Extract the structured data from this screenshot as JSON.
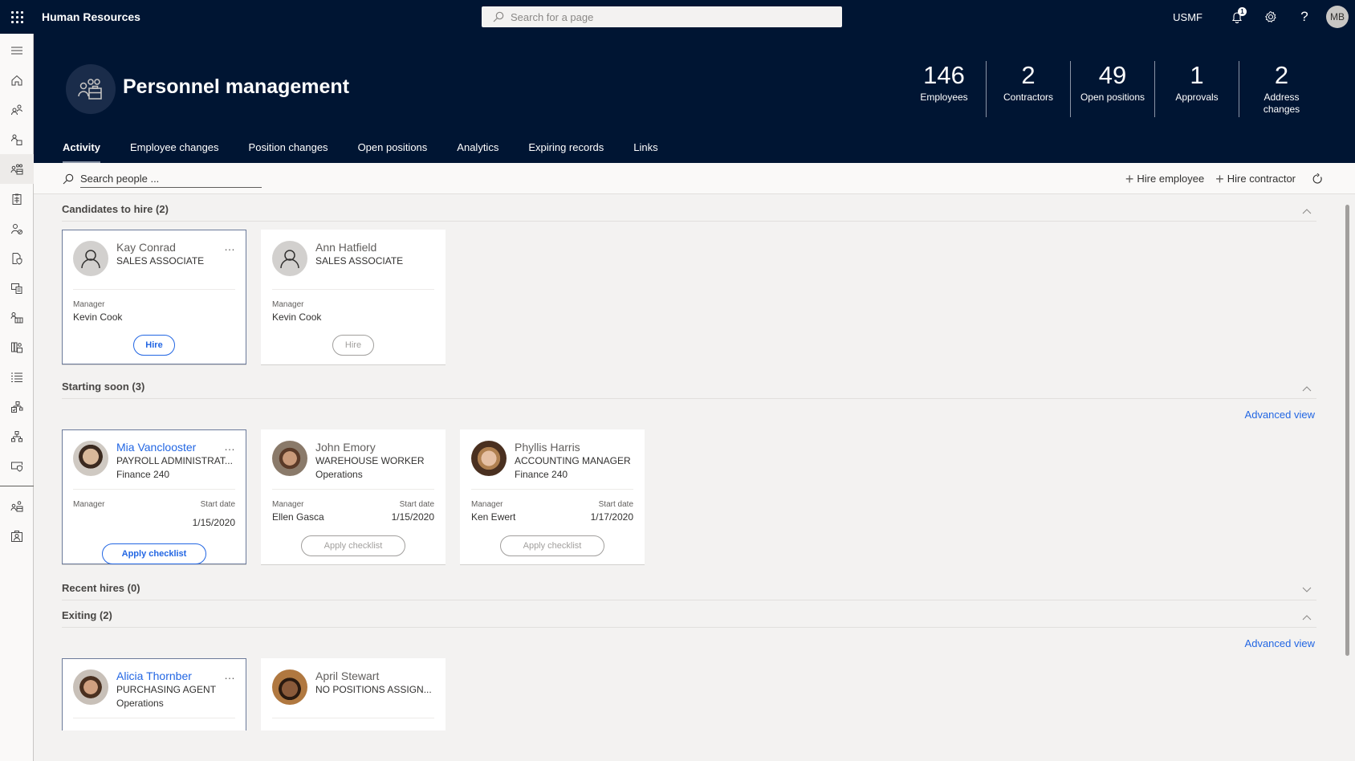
{
  "topbar": {
    "app_title": "Human Resources",
    "search_placeholder": "Search for a page",
    "company": "USMF",
    "notification_count": "1",
    "user_initials": "MB"
  },
  "leftnav": {
    "items": [
      "menu",
      "home",
      "people",
      "people-document",
      "personnel-management",
      "clipboard",
      "person-blocked",
      "document-shield",
      "card-document",
      "person-team",
      "binder-briefcase",
      "list",
      "org-check",
      "org-chart",
      "screen-shield",
      "people-briefcase",
      "person-swap"
    ],
    "active": "personnel-management"
  },
  "header": {
    "title": "Personnel management",
    "kpis": [
      {
        "value": "146",
        "label": "Employees"
      },
      {
        "value": "2",
        "label": "Contractors"
      },
      {
        "value": "49",
        "label": "Open positions"
      },
      {
        "value": "1",
        "label": "Approvals"
      },
      {
        "value": "2",
        "label": "Address changes"
      }
    ],
    "tabs": [
      "Activity",
      "Employee changes",
      "Position changes",
      "Open positions",
      "Analytics",
      "Expiring records",
      "Links"
    ],
    "active_tab": "Activity"
  },
  "toolbar": {
    "search_placeholder": "Search people ...",
    "hire_employee": "Hire employee",
    "hire_contractor": "Hire contractor"
  },
  "sections": {
    "candidates": {
      "title": "Candidates to hire (2)",
      "cards": [
        {
          "name": "Kay Conrad",
          "title": "SALES ASSOCIATE",
          "manager_label": "Manager",
          "manager": "Kevin Cook",
          "button": "Hire"
        },
        {
          "name": "Ann Hatfield",
          "title": "SALES ASSOCIATE",
          "manager_label": "Manager",
          "manager": "Kevin Cook",
          "button": "Hire"
        }
      ]
    },
    "starting_soon": {
      "title": "Starting soon (3)",
      "advanced_view": "Advanced view",
      "cards": [
        {
          "name": "Mia Vanclooster",
          "title": "PAYROLL ADMINISTRAT...",
          "dept": "Finance 240",
          "manager_label": "Manager",
          "manager": "",
          "start_label": "Start date",
          "start_date": "1/15/2020",
          "button": "Apply checklist"
        },
        {
          "name": "John Emory",
          "title": "WAREHOUSE WORKER",
          "dept": "Operations",
          "manager_label": "Manager",
          "manager": "Ellen Gasca",
          "start_label": "Start date",
          "start_date": "1/15/2020",
          "button": "Apply checklist"
        },
        {
          "name": "Phyllis Harris",
          "title": "ACCOUNTING MANAGER",
          "dept": "Finance 240",
          "manager_label": "Manager",
          "manager": "Ken Ewert",
          "start_label": "Start date",
          "start_date": "1/17/2020",
          "button": "Apply checklist"
        }
      ]
    },
    "recent_hires": {
      "title": "Recent hires (0)"
    },
    "exiting": {
      "title": "Exiting (2)",
      "advanced_view": "Advanced view",
      "cards": [
        {
          "name": "Alicia Thornber",
          "title": "PURCHASING AGENT",
          "dept": "Operations"
        },
        {
          "name": "April Stewart",
          "title": "NO POSITIONS ASSIGN..."
        }
      ]
    }
  },
  "colors": {
    "header_bg": "#001533",
    "accent": "#2266e3",
    "page_bg": "#f3f2f1"
  }
}
